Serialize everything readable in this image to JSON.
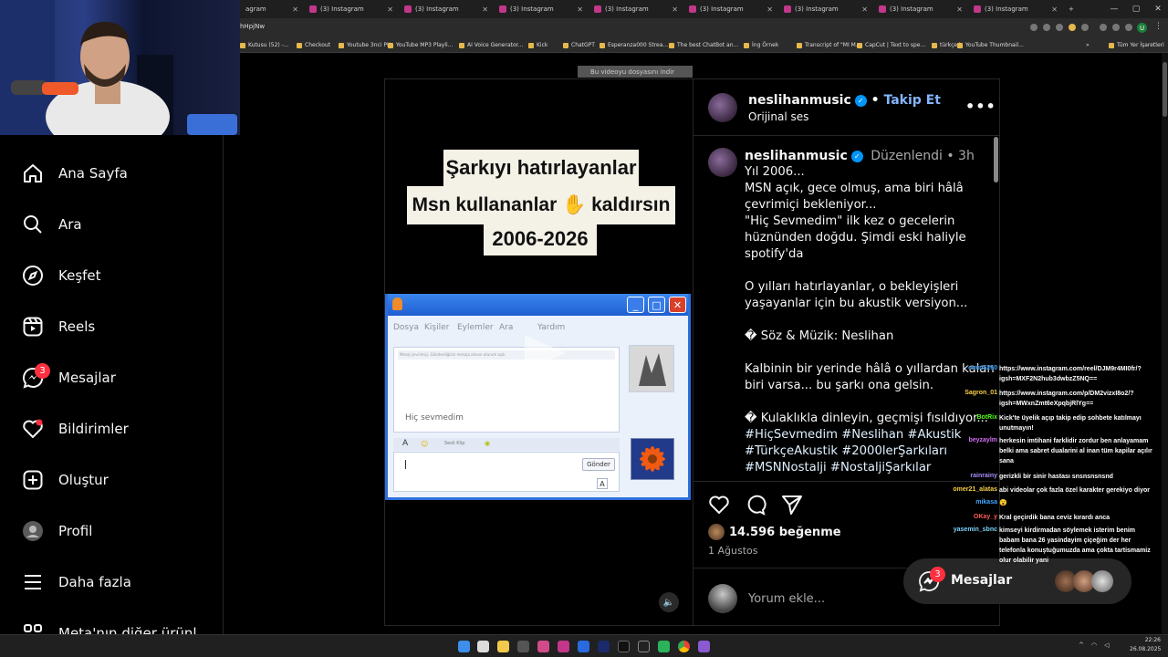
{
  "browser": {
    "tabs": [
      {
        "label": "agram"
      },
      {
        "label": "(3) Instagram"
      },
      {
        "label": "(3) Instagram"
      },
      {
        "label": "(3) Instagram"
      },
      {
        "label": "(3) Instagram"
      },
      {
        "label": "(3) Instagram"
      },
      {
        "label": "(3) Instagram"
      },
      {
        "label": "(3) Instagram"
      },
      {
        "label": "(3) Instagram"
      }
    ],
    "new_tab": "+",
    "url_fragment": "hHpjNw",
    "bookmarks": [
      "Kutusu (52) -...",
      "Checkout",
      "Youtube 3nci PK",
      "YouTube MP3 Playli...",
      "AI Voice Generator...",
      "Kick",
      "ChatGPT",
      "Esperanza000 Strea...",
      "The best ChatBot an...",
      "İng Örnek",
      "Transcript of \"MI M...",
      "CapCut | Text to spe...",
      "türkçe h",
      "YouTube Thumbnail..."
    ],
    "bookmarks_more": "»",
    "all_bookmarks": "Tüm Yer İşaretleri",
    "profile_initial": "U"
  },
  "nav": {
    "items": [
      {
        "label": "Ana Sayfa",
        "icon": "home-icon"
      },
      {
        "label": "Ara",
        "icon": "search-icon"
      },
      {
        "label": "Keşfet",
        "icon": "compass-icon"
      },
      {
        "label": "Reels",
        "icon": "reels-icon"
      },
      {
        "label": "Mesajlar",
        "icon": "messenger-icon",
        "badge": "3"
      },
      {
        "label": "Bildirimler",
        "icon": "heart-icon"
      },
      {
        "label": "Oluştur",
        "icon": "plus-square-icon"
      },
      {
        "label": "Profil",
        "icon": "profile-avatar"
      },
      {
        "label": "Daha fazla",
        "icon": "menu-icon"
      },
      {
        "label": "Meta'nın diğer ürünl",
        "icon": "meta-icon"
      }
    ]
  },
  "video": {
    "download_hint": "Bu videoyu dosyasını indir",
    "caption_lines": [
      "Şarkıyı hatırlayanlar",
      "Msn kullananlar ✋ kaldırsın",
      "2006-2026"
    ],
    "msn_menu": [
      "Dosya",
      "Kişiler",
      "Eylemler",
      "Ara",
      "Yardım"
    ],
    "msn_status": "Mesaj çevrimiçi, Gönderdiğiniz mesaja alınan oturum açık",
    "msn_song": "Hiç sevmedim",
    "msn_send": "Gönder",
    "msn_font_a": "A",
    "msn_voice": "Sesli Klip"
  },
  "post": {
    "username": "neslihanmusic",
    "follow": "Takip Et",
    "audio": "Orijinal ses",
    "edited": "Düzenlendi",
    "dot": "•",
    "time": "3h",
    "caption": [
      "Yıl 2006...",
      "MSN açık, gece olmuş, ama biri hâlâ",
      "çevrimiçi bekleniyor...",
      "\"Hiç Sevmedim\" ilk kez o gecelerin",
      "hüznünden doğdu.  Şimdi eski haliyle",
      "spotify'da",
      "",
      "O yılları hatırlayanlar, o bekleyişleri",
      "yaşayanlar için bu akustik versiyon...",
      "",
      "� Söz & Müzik: Neslihan",
      "",
      "Kalbinin bir yerinde hâlâ o yıllardan kalan",
      "biri varsa... bu şarkı ona gelsin.",
      "",
      "� Kulaklıkla dinleyin, geçmişi fısıldıyor..."
    ],
    "hashtags": [
      "#HiçSevmedim #Neslihan #Akustik",
      "#TürkçeAkustik #2000lerŞarkıları",
      "#MSNNostalji #NostaljiŞarkılar"
    ],
    "likes": "14.596 beğenme",
    "date": "1 Ağustos",
    "comment_placeholder": "Yorum ekle..."
  },
  "messages_float": {
    "label": "Mesajlar",
    "badge": "3"
  },
  "chat": [
    {
      "user": "emin5260",
      "color": "#3ea6ff",
      "text": [
        "https://www.instagram.com/reel/DJM9r4MI0fr/?",
        "igsh=MXF2N2hub3dwbzZ5NQ=="
      ]
    },
    {
      "user": "Sagron_01",
      "color": "#f7d046",
      "text": [
        "https://www.instagram.com/p/DM2vizxI8o2/?",
        "igsh=MWxnZmt6eXpqbjRlYg=="
      ]
    },
    {
      "user": "BotRix",
      "color": "#53fc18",
      "text": [
        "Kick'te üyelik açıp takip edip sohbete katılmayı",
        "unutmayın!"
      ]
    },
    {
      "user": "beyzaylm",
      "color": "#d36cf2",
      "text": [
        "herkesin imtihani farklidir zordur ben anlayamam",
        "belki ama sabret dualarini al inan tüm kapilar açılır",
        "sana"
      ]
    },
    {
      "user": "rainrainy",
      "color": "#a78bfa",
      "text": [
        "gerizkli bir sinir hastası snsnsnsnsnd"
      ]
    },
    {
      "user": "omer21_alatas",
      "color": "#f7d046",
      "text": [
        "abi videolar çok fazla özel karakter gerekiyo diyor"
      ]
    },
    {
      "user": "mikasa",
      "color": "#3ea6ff",
      "text": [
        "😮"
      ]
    },
    {
      "user": "OKay_y",
      "color": "#ff5a5a",
      "text": [
        "Kral geçirdik bana ceviz kırardı anca"
      ]
    },
    {
      "user": "yasemin_sbnc",
      "color": "#7dd3fc",
      "text": [
        "kimseyi kirdirmadan söylemek isterim benim",
        "babam bana 26 yasindayim çiçeğim der her",
        "telefonla konuştuğumuzda ama çokta tartismamiz",
        "olur olabilir yani"
      ]
    }
  ],
  "taskbar": {
    "time": "22:26",
    "date": "26.08.2025"
  }
}
